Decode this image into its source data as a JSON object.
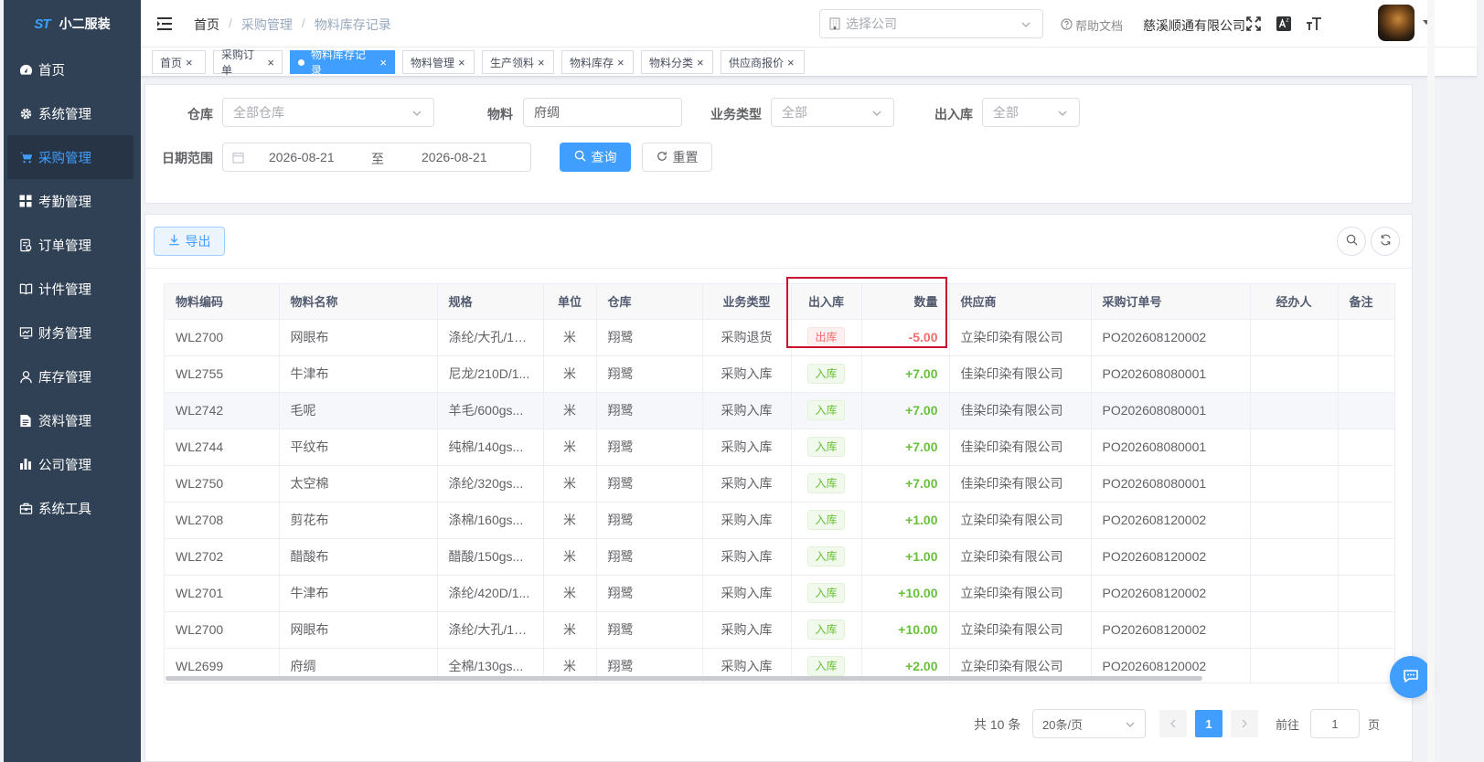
{
  "app": {
    "name": "小二服装",
    "logo_mark": "ST"
  },
  "sidebar": {
    "items": [
      {
        "label": "首页",
        "icon": "dashboard-icon"
      },
      {
        "label": "系统管理",
        "icon": "gear-icon"
      },
      {
        "label": "采购管理",
        "icon": "cart-icon",
        "active": true
      },
      {
        "label": "考勤管理",
        "icon": "grid-icon"
      },
      {
        "label": "订单管理",
        "icon": "document-icon"
      },
      {
        "label": "计件管理",
        "icon": "book-icon"
      },
      {
        "label": "财务管理",
        "icon": "chart-monitor-icon"
      },
      {
        "label": "库存管理",
        "icon": "user-icon"
      },
      {
        "label": "资料管理",
        "icon": "file-icon"
      },
      {
        "label": "公司管理",
        "icon": "bar-chart-icon"
      },
      {
        "label": "系统工具",
        "icon": "toolbox-icon"
      }
    ]
  },
  "navbar": {
    "breadcrumb": [
      "首页",
      "采购管理",
      "物料库存记录"
    ],
    "breadcrumb_sep": "/",
    "company_select_placeholder": "选择公司",
    "help_label": "帮助文档",
    "company_name": "慈溪顺通有限公司"
  },
  "tags": [
    {
      "label": "首页",
      "active": false
    },
    {
      "label": "采购订单",
      "active": false
    },
    {
      "label": "物料库存记录",
      "active": true
    },
    {
      "label": "物料管理",
      "active": false
    },
    {
      "label": "生产领料",
      "active": false
    },
    {
      "label": "物料库存",
      "active": false
    },
    {
      "label": "物料分类",
      "active": false
    },
    {
      "label": "供应商报价",
      "active": false
    }
  ],
  "filters": {
    "warehouse_label": "仓库",
    "warehouse_placeholder": "全部仓库",
    "material_label": "物料",
    "material_value": "府绸",
    "biz_type_label": "业务类型",
    "biz_type_value": "全部",
    "in_out_label": "出入库",
    "in_out_value": "全部",
    "date_label": "日期范围",
    "date_start": "2026-08-21",
    "date_to": "至",
    "date_end": "2026-08-21",
    "search_btn": "查询",
    "reset_btn": "重置"
  },
  "toolbar": {
    "export_btn": "导出"
  },
  "table": {
    "columns": [
      "物料编码",
      "物料名称",
      "规格",
      "单位",
      "仓库",
      "业务类型",
      "出入库",
      "数量",
      "供应商",
      "采购订单号",
      "经办人",
      "备注"
    ],
    "rows": [
      {
        "code": "WL2700",
        "name": "网眼布",
        "spec": "涤纶/大孔/15...",
        "unit": "米",
        "warehouse": "翔鹭",
        "biz": "采购退货",
        "dir": "出库",
        "dir_type": "out",
        "qty": "-5.00",
        "supplier": "立染印染有限公司",
        "po": "PO202608120002",
        "handler": "",
        "note": ""
      },
      {
        "code": "WL2755",
        "name": "牛津布",
        "spec": "尼龙/210D/1...",
        "unit": "米",
        "warehouse": "翔鹭",
        "biz": "采购入库",
        "dir": "入库",
        "dir_type": "in",
        "qty": "+7.00",
        "supplier": "佳染印染有限公司",
        "po": "PO202608080001",
        "handler": "",
        "note": ""
      },
      {
        "code": "WL2742",
        "name": "毛呢",
        "spec": "羊毛/600gs...",
        "unit": "米",
        "warehouse": "翔鹭",
        "biz": "采购入库",
        "dir": "入库",
        "dir_type": "in",
        "qty": "+7.00",
        "supplier": "佳染印染有限公司",
        "po": "PO202608080001",
        "handler": "",
        "note": ""
      },
      {
        "code": "WL2744",
        "name": "平纹布",
        "spec": "纯棉/140gs...",
        "unit": "米",
        "warehouse": "翔鹭",
        "biz": "采购入库",
        "dir": "入库",
        "dir_type": "in",
        "qty": "+7.00",
        "supplier": "佳染印染有限公司",
        "po": "PO202608080001",
        "handler": "",
        "note": ""
      },
      {
        "code": "WL2750",
        "name": "太空棉",
        "spec": "涤纶/320gs...",
        "unit": "米",
        "warehouse": "翔鹭",
        "biz": "采购入库",
        "dir": "入库",
        "dir_type": "in",
        "qty": "+7.00",
        "supplier": "佳染印染有限公司",
        "po": "PO202608080001",
        "handler": "",
        "note": ""
      },
      {
        "code": "WL2708",
        "name": "剪花布",
        "spec": "涤棉/160gs...",
        "unit": "米",
        "warehouse": "翔鹭",
        "biz": "采购入库",
        "dir": "入库",
        "dir_type": "in",
        "qty": "+1.00",
        "supplier": "立染印染有限公司",
        "po": "PO202608120002",
        "handler": "",
        "note": ""
      },
      {
        "code": "WL2702",
        "name": "醋酸布",
        "spec": "醋酸/150gs...",
        "unit": "米",
        "warehouse": "翔鹭",
        "biz": "采购入库",
        "dir": "入库",
        "dir_type": "in",
        "qty": "+1.00",
        "supplier": "立染印染有限公司",
        "po": "PO202608120002",
        "handler": "",
        "note": ""
      },
      {
        "code": "WL2701",
        "name": "牛津布",
        "spec": "涤纶/420D/1...",
        "unit": "米",
        "warehouse": "翔鹭",
        "biz": "采购入库",
        "dir": "入库",
        "dir_type": "in",
        "qty": "+10.00",
        "supplier": "立染印染有限公司",
        "po": "PO202608120002",
        "handler": "",
        "note": ""
      },
      {
        "code": "WL2700",
        "name": "网眼布",
        "spec": "涤纶/大孔/15...",
        "unit": "米",
        "warehouse": "翔鹭",
        "biz": "采购入库",
        "dir": "入库",
        "dir_type": "in",
        "qty": "+10.00",
        "supplier": "立染印染有限公司",
        "po": "PO202608120002",
        "handler": "",
        "note": ""
      },
      {
        "code": "WL2699",
        "name": "府绸",
        "spec": "全棉/130gs...",
        "unit": "米",
        "warehouse": "翔鹭",
        "biz": "采购入库",
        "dir": "入库",
        "dir_type": "in",
        "qty": "+2.00",
        "supplier": "立染印染有限公司",
        "po": "PO202608120002",
        "handler": "",
        "note": ""
      }
    ]
  },
  "pagination": {
    "total": "共 10 条",
    "page_size": "20条/页",
    "current_page": "1",
    "goto_label": "前往",
    "goto_value": "1",
    "page_suffix": "页"
  },
  "colors": {
    "primary": "#409eff",
    "sidebar_bg": "#304156",
    "in": "#67c23a",
    "out": "#f56c6c",
    "highlight": "#c8102e"
  }
}
